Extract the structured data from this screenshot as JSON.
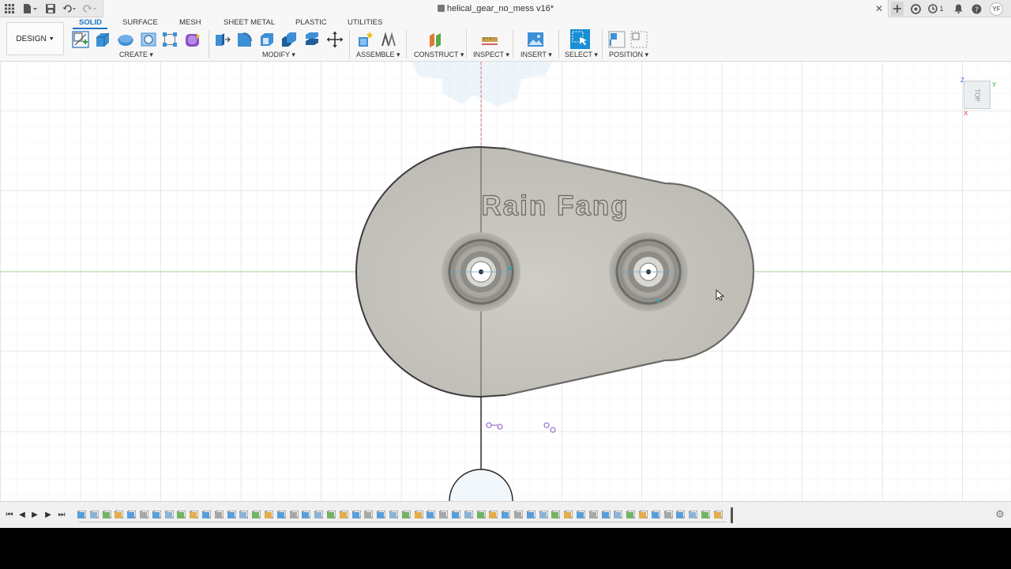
{
  "titlebar": {
    "document_title": "helical_gear_no_mess v16*",
    "job_count": "1",
    "user_initials": "YF",
    "icons": [
      "grid-menu-icon",
      "file-icon",
      "save-icon",
      "undo-icon",
      "redo-icon",
      "new-tab-icon",
      "extensions-icon",
      "jobs-icon",
      "notifications-icon",
      "help-icon"
    ]
  },
  "toolbar": {
    "workspace_label": "DESIGN",
    "tabs": [
      "SOLID",
      "SURFACE",
      "MESH",
      "SHEET METAL",
      "PLASTIC",
      "UTILITIES"
    ],
    "active_tab": "SOLID",
    "groups": [
      "CREATE",
      "MODIFY",
      "ASSEMBLE",
      "CONSTRUCT",
      "INSPECT",
      "INSERT",
      "SELECT",
      "POSITION"
    ],
    "accent_color": "#1a73c9"
  },
  "viewport": {
    "embossed_text": "Rain Fang",
    "view_cube_label": "TOP",
    "axis_labels": {
      "z": "Z",
      "y": "Y",
      "x": "X"
    },
    "part_color": "#c5c3bd"
  },
  "timeline": {
    "controls": [
      "go-to-start",
      "step-back",
      "play",
      "step-forward",
      "go-to-end"
    ]
  }
}
